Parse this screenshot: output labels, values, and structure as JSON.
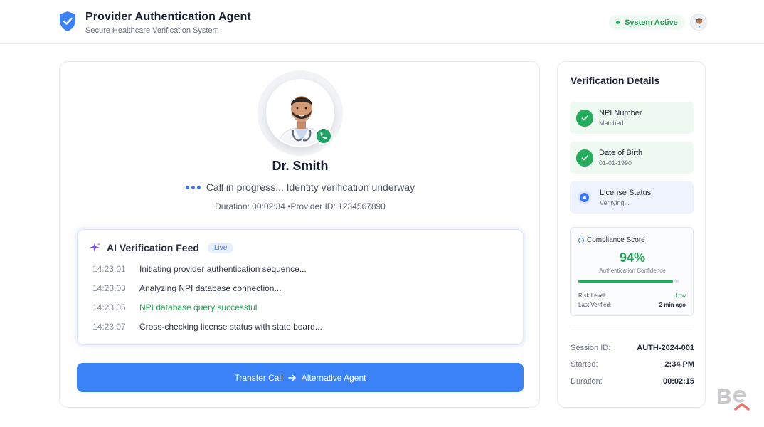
{
  "header": {
    "title": "Provider Authentication Agent",
    "subtitle": "Secure Healthcare Verification System",
    "status": "System Active",
    "brand_icon": "shield-check-icon",
    "colors": {
      "status": "#22b35b",
      "accent": "#3b82f6"
    }
  },
  "call": {
    "name": "Dr. Smith",
    "status": "Call in progress... Identity verification underway",
    "duration_label": "Duration: 00:02:34",
    "provider_label": "•Provider ID: 1234567890"
  },
  "feed": {
    "title": "AI Verification Feed",
    "badge": "Live",
    "entries": [
      {
        "time": "14:23:01",
        "message": "Initiating provider authentication sequence..."
      },
      {
        "time": "14:23:03",
        "message": "Analyzing NPI database connection..."
      },
      {
        "time": "14:23:05",
        "message": "NPI database query successful"
      },
      {
        "time": "14:23:07",
        "message": "Cross-checking license status with state board..."
      }
    ]
  },
  "actions": {
    "transfer_label": "Transfer Call",
    "transfer_target": "Alternative Agent"
  },
  "details": {
    "title": "Verification Details",
    "items": [
      {
        "label": "NPI Number",
        "sub": "Matched",
        "state": "verified"
      },
      {
        "label": "Date of Birth",
        "sub": "01-01-1990",
        "state": "verified"
      },
      {
        "label": "License Status",
        "sub": "Verifying...",
        "state": "pending"
      }
    ],
    "compliance": {
      "title": "Compliance Score",
      "score": "94%",
      "score_fraction": 0.94,
      "caption": "Authentication Confidence",
      "risk_label": "Risk Level:",
      "risk_value": "Low",
      "verified_label": "Last Verified:",
      "verified_value": "2 min ago"
    },
    "session": [
      {
        "key": "Session ID:",
        "value": "AUTH-2024-001"
      },
      {
        "key": "Started:",
        "value": "2:34 PM"
      },
      {
        "key": "Duration:",
        "value": "00:02:15"
      }
    ]
  }
}
